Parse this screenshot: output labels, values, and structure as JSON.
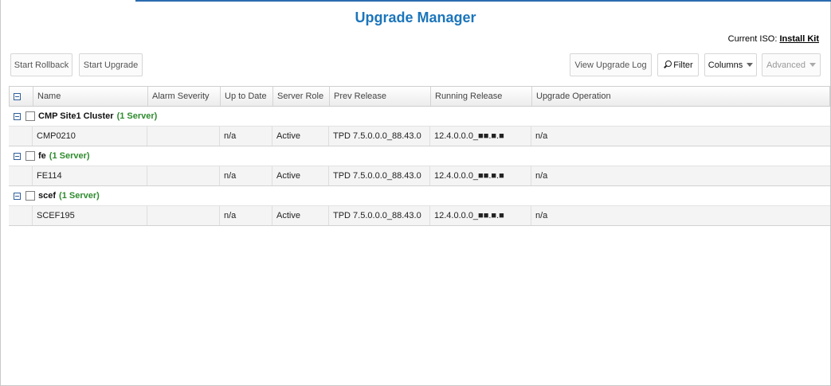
{
  "page": {
    "title": "Upgrade Manager"
  },
  "iso": {
    "label": "Current ISO:",
    "link": "Install Kit"
  },
  "toolbar": {
    "start_rollback": "Start Rollback",
    "start_upgrade": "Start Upgrade",
    "view_upgrade_log": "View Upgrade Log",
    "filter": "Filter",
    "columns": "Columns",
    "advanced": "Advanced"
  },
  "table": {
    "headers": [
      "Name",
      "Alarm Severity",
      "Up to Date",
      "Server Role",
      "Prev Release",
      "Running Release",
      "Upgrade Operation"
    ],
    "groups": [
      {
        "name": "CMP Site1 Cluster",
        "count": "(1 Server)",
        "row": {
          "name": "CMP0210",
          "alarm": "",
          "up_to_date": "n/a",
          "role": "Active",
          "prev": "TPD 7.5.0.0.0_88.43.0",
          "running": "12.4.0.0.0_■■.■.■",
          "operation": "n/a"
        }
      },
      {
        "name": "fe",
        "count": "(1 Server)",
        "row": {
          "name": "FE114",
          "alarm": "",
          "up_to_date": "n/a",
          "role": "Active",
          "prev": "TPD 7.5.0.0.0_88.43.0",
          "running": "12.4.0.0.0_■■.■.■",
          "operation": "n/a"
        }
      },
      {
        "name": "scef",
        "count": "(1 Server)",
        "row": {
          "name": "SCEF195",
          "alarm": "",
          "up_to_date": "n/a",
          "role": "Active",
          "prev": "TPD 7.5.0.0.0_88.43.0",
          "running": "12.4.0.0.0_■■.■.■",
          "operation": "n/a"
        }
      }
    ]
  },
  "colors": {
    "title": "#1b75bb",
    "group_count": "#2e8b2e"
  }
}
